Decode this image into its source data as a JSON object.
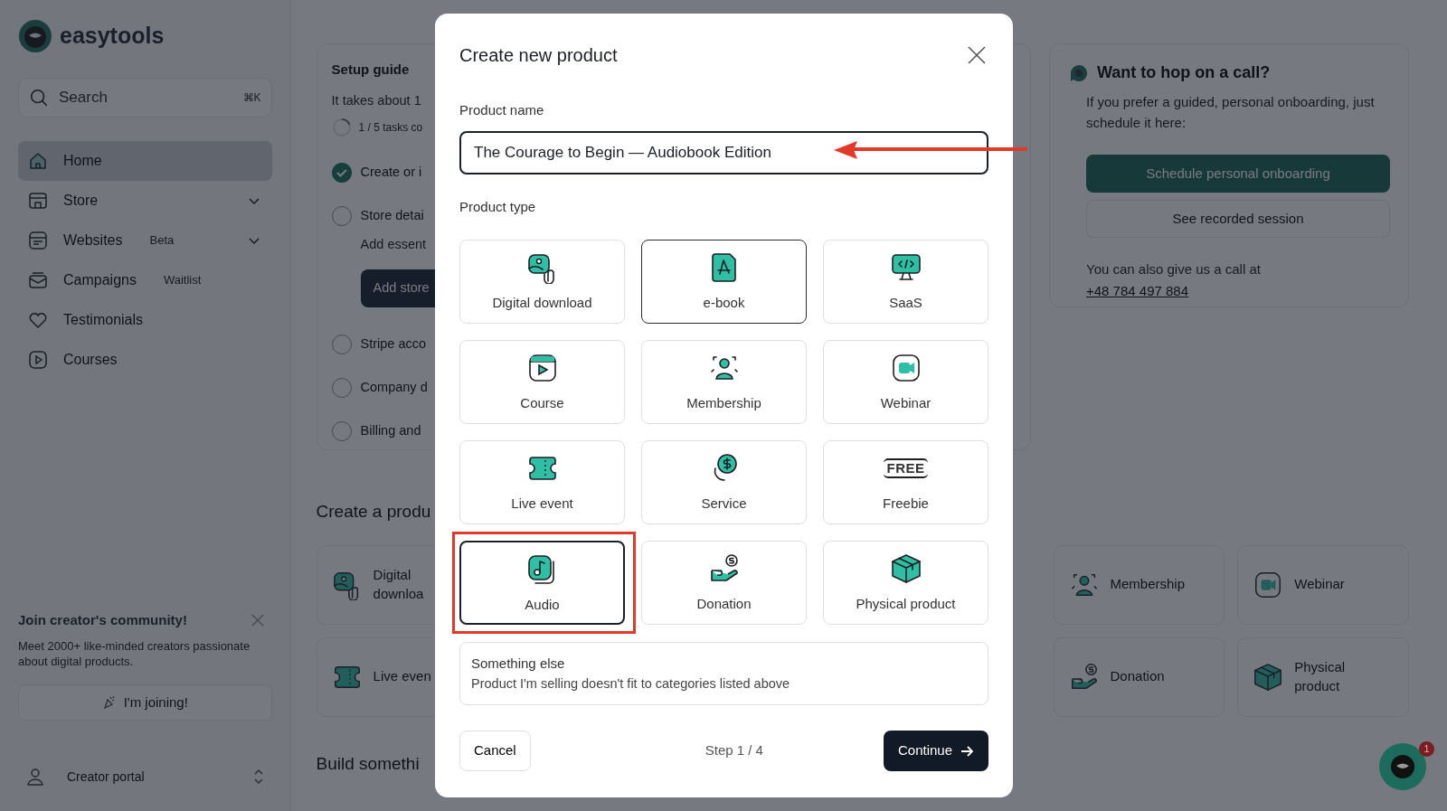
{
  "sidebar": {
    "logo": "easytools",
    "search": {
      "placeholder": "Search",
      "shortcut": "⌘K"
    },
    "items": [
      {
        "label": "Home",
        "selected": true,
        "expandable": false
      },
      {
        "label": "Store",
        "selected": false,
        "expandable": true
      },
      {
        "label": "Websites",
        "tag": "Beta",
        "selected": false,
        "expandable": true
      },
      {
        "label": "Campaigns",
        "tag": "Waitlist",
        "selected": false,
        "expandable": false
      },
      {
        "label": "Testimonials",
        "selected": false,
        "expandable": false
      },
      {
        "label": "Courses",
        "selected": false,
        "expandable": false
      }
    ],
    "community": {
      "title": "Join creator's community!",
      "text": "Meet 2000+ like-minded creators passionate about digital products.",
      "button": "I'm joining!"
    },
    "footer": "Creator portal"
  },
  "setup_guide": {
    "title": "Setup guide",
    "subtitle": "It takes about 1",
    "progress": "1 / 5 tasks co",
    "tasks": [
      {
        "label": "Create or i",
        "done": true
      },
      {
        "label": "Store detai",
        "done": false,
        "description": "Add essent",
        "button": "Add store"
      },
      {
        "label": "Stripe acco",
        "done": false
      },
      {
        "label": "Company d",
        "done": false
      },
      {
        "label": "Billing and",
        "done": false
      }
    ]
  },
  "call_card": {
    "title": "Want to hop on a call?",
    "text": "If you prefer a guided, personal onboarding, just schedule it here:",
    "primary_button": "Schedule personal onboarding",
    "secondary_button": "See recorded session",
    "phone_text": "You can also give us a call at",
    "phone": "+48 784 497 884"
  },
  "create_product": {
    "title": "Create a produ",
    "cards": [
      {
        "label": "Digital downloa"
      },
      {
        "label": "Membership"
      },
      {
        "label": "Webinar"
      },
      {
        "label": "Live even"
      },
      {
        "label": "Donation"
      },
      {
        "label": "Physical product"
      }
    ]
  },
  "build_title": "Build somethi",
  "chat": {
    "badge": "1"
  },
  "modal": {
    "title": "Create new product",
    "name_label": "Product name",
    "name_value": "The Courage to Begin — Audiobook Edition",
    "type_label": "Product type",
    "types": [
      {
        "label": "Digital download",
        "selected": false,
        "hovered": false
      },
      {
        "label": "e-book",
        "selected": false,
        "hovered": true
      },
      {
        "label": "SaaS",
        "selected": false,
        "hovered": false
      },
      {
        "label": "Course",
        "selected": false,
        "hovered": false
      },
      {
        "label": "Membership",
        "selected": false,
        "hovered": false
      },
      {
        "label": "Webinar",
        "selected": false,
        "hovered": false
      },
      {
        "label": "Live event",
        "selected": false,
        "hovered": false
      },
      {
        "label": "Service",
        "selected": false,
        "hovered": false
      },
      {
        "label": "Freebie",
        "selected": false,
        "hovered": false
      },
      {
        "label": "Audio",
        "selected": true,
        "hovered": false
      },
      {
        "label": "Donation",
        "selected": false,
        "hovered": false
      },
      {
        "label": "Physical product",
        "selected": false,
        "hovered": false
      }
    ],
    "freebie_icon_text": "FREE",
    "other": {
      "title": "Something else",
      "text": "Product I'm selling doesn't fit to categories listed above"
    },
    "cancel": "Cancel",
    "step": "Step 1 / 4",
    "continue": "Continue"
  }
}
